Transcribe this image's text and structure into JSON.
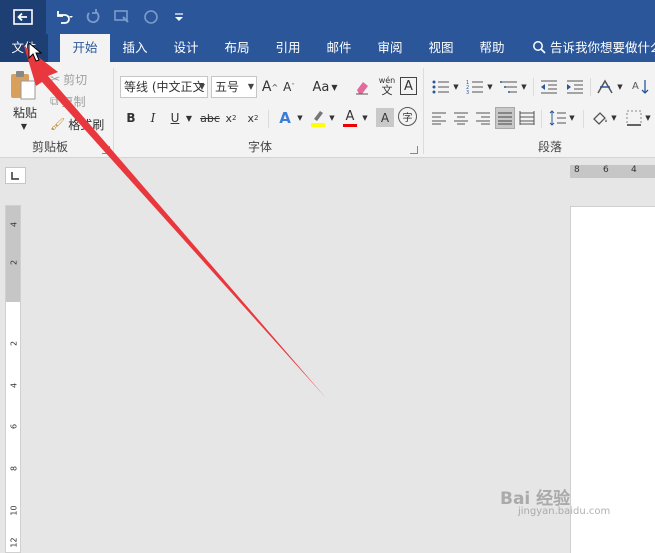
{
  "quick_access": {
    "back_icon": "back-arrow-icon",
    "undo_icon": "undo-icon",
    "redo_icon": "redo-icon",
    "touch_icon": "touch-mode-icon",
    "circle_icon": "circle-icon",
    "customize_icon": "customize-dropdown-icon"
  },
  "tabs": [
    {
      "label": "文件"
    },
    {
      "label": "开始"
    },
    {
      "label": "插入"
    },
    {
      "label": "设计"
    },
    {
      "label": "布局"
    },
    {
      "label": "引用"
    },
    {
      "label": "邮件"
    },
    {
      "label": "审阅"
    },
    {
      "label": "视图"
    },
    {
      "label": "帮助"
    }
  ],
  "active_tab": "开始",
  "tell_me": "告诉我你想要做什么",
  "clipboard": {
    "paste": "粘贴",
    "cut": "剪切",
    "copy": "复制",
    "format_painter": "格式刷",
    "group_label": "剪贴板"
  },
  "font": {
    "font_name": "等线 (中文正文",
    "font_size": "五号",
    "grow": "A",
    "shrink": "A",
    "case": "Aa",
    "phonetic": "wén",
    "phonetic_char": "文",
    "border_char": "A",
    "bold": "B",
    "italic": "I",
    "underline": "U",
    "strike": "abc",
    "sub": "x",
    "sup": "x",
    "text_effect": "A",
    "font_color": "A",
    "shading": "A",
    "enclose": "字",
    "group_label": "字体"
  },
  "paragraph": {
    "group_label": "段落"
  },
  "ruler": {
    "horizontal": [
      "8",
      "6",
      "4"
    ],
    "vertical": [
      "4",
      "2",
      "2",
      "4",
      "6",
      "8",
      "10",
      "12"
    ]
  },
  "watermark": {
    "text": "Bai 经验",
    "sub": "jingyan.baidu.com"
  },
  "colors": {
    "title_bar": "#2b579a",
    "file_tab": "#1e3f73",
    "ribbon": "#f3f3f3",
    "canvas": "#e6e6e6",
    "arrow": "#e8383d"
  }
}
